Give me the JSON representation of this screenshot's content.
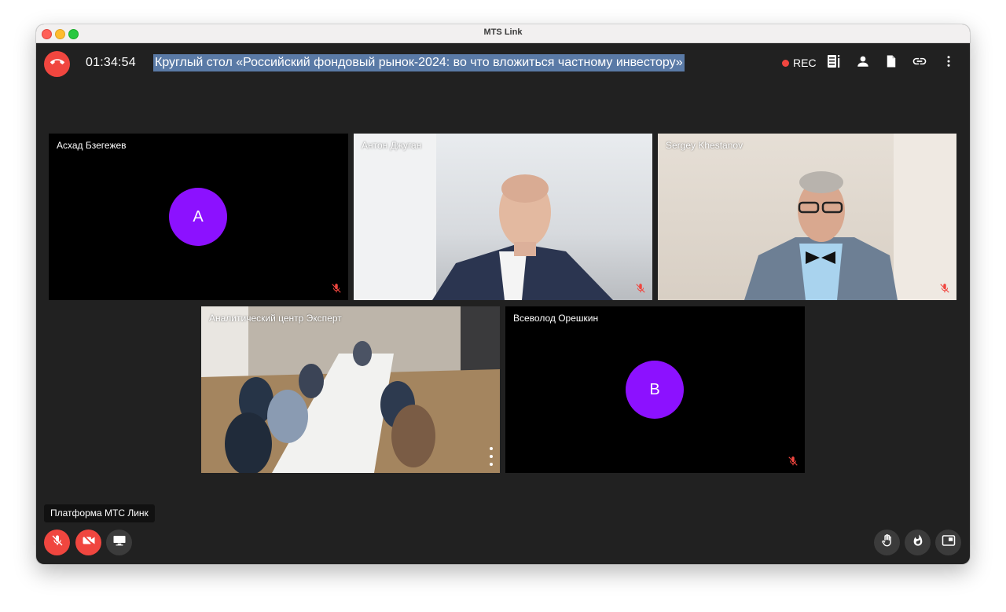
{
  "window": {
    "title": "MTS Link"
  },
  "topbar": {
    "timer": "01:34:54",
    "meeting_title": "Круглый стол «Российский фондовый рынок-2024: во что вложиться частному инвестору»",
    "rec_label": "REC",
    "icons": [
      "end-call-icon",
      "agenda-icon",
      "participants-icon",
      "document-icon",
      "link-icon",
      "more-icon"
    ]
  },
  "participants": [
    {
      "name": "Асхад Бзегежев",
      "avatar_letter": "А",
      "video": false,
      "muted": true
    },
    {
      "name": "Антон Джуган",
      "video": true,
      "muted": true
    },
    {
      "name": "Sergey Khestanov",
      "video": true,
      "muted": true
    },
    {
      "name": "Аналитический центр Эксперт",
      "video": true,
      "active_speaker": true
    },
    {
      "name": "Всеволод Орешкин",
      "avatar_letter": "В",
      "video": false,
      "muted": true
    }
  ],
  "tooltip": {
    "text": "Платформа МТС Линк"
  },
  "colors": {
    "accent": "#8c11ff",
    "danger": "#f0463f",
    "background": "#212121",
    "selection": "#5a7aa6"
  }
}
